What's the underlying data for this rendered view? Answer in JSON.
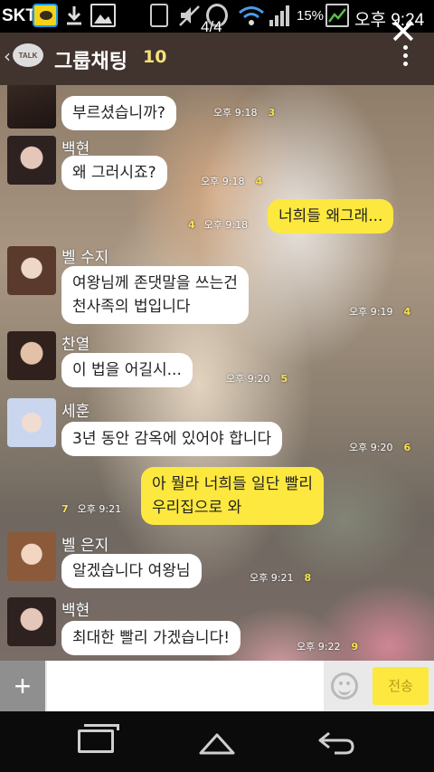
{
  "status_bar": {
    "carrier": "SKT",
    "battery": "15%",
    "time": "오후 9:24"
  },
  "viewer": {
    "page_indicator": "4/4"
  },
  "header": {
    "back_glyph": "‹",
    "logo_text": "TALK",
    "title": "그룹채팅",
    "member_count": "10"
  },
  "messages": [
    {
      "sender": "",
      "text": "부르셨습니까?",
      "time": "오후 9:18",
      "unread": "3"
    },
    {
      "sender": "백현",
      "text": "왜 그러시죠?",
      "time": "오후 9:18",
      "unread": "4"
    },
    {
      "sender": "",
      "text": "너희들 왜그래...",
      "time": "오후 9:18",
      "unread": "4",
      "mine": true
    },
    {
      "sender": "벨 수지",
      "text_lines": [
        "여왕님께 존댓말을 쓰는건",
        "천사족의 법입니다"
      ],
      "time": "오후 9:19",
      "unread": "4"
    },
    {
      "sender": "찬열",
      "text": "이 법을 어길시...",
      "time": "오후 9:20",
      "unread": "5"
    },
    {
      "sender": "세훈",
      "text": "3년 동안 감옥에 있어야 합니다",
      "time": "오후 9:20",
      "unread": "6"
    },
    {
      "sender": "",
      "text_lines": [
        "아 뭘라 너희들 일단 빨리",
        "우리집으로 와"
      ],
      "time": "오후 9:21",
      "unread": "7",
      "mine": true
    },
    {
      "sender": "벨 은지",
      "text": "알겠습니다 여왕님",
      "time": "오후 9:21",
      "unread": "8"
    },
    {
      "sender": "백현",
      "text": "최대한 빨리 가겠습니다!",
      "time": "오후 9:22",
      "unread": "9"
    }
  ],
  "input": {
    "plus_glyph": "+",
    "placeholder": "",
    "send_label": "전송"
  },
  "colors": {
    "my_bubble": "#fde83f",
    "other_bubble": "#ffffff",
    "unread_count": "#f7e24a",
    "title_bar": "#463732"
  },
  "icons": [
    "kakaotalk-icon",
    "download-icon",
    "gallery-icon",
    "phone-icon",
    "mute-icon",
    "alarm-icon",
    "wifi-icon",
    "signal-icon",
    "battery-icon",
    "close-icon",
    "menu-icon",
    "emoji-icon",
    "recent-apps-icon",
    "home-icon",
    "back-icon"
  ]
}
